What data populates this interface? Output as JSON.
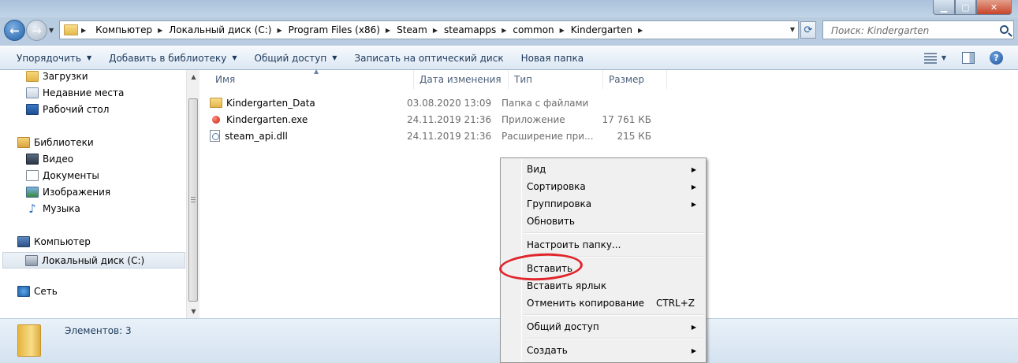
{
  "address": {
    "crumbs": [
      "Компьютер",
      "Локальный диск (C:)",
      "Program Files (x86)",
      "Steam",
      "steamapps",
      "common",
      "Kindergarten"
    ]
  },
  "search": {
    "placeholder": "Поиск: Kindergarten"
  },
  "toolbar": {
    "organize": "Упорядочить",
    "add_to_library": "Добавить в библиотеку",
    "share": "Общий доступ",
    "burn": "Записать на оптический диск",
    "new_folder": "Новая папка"
  },
  "sidebar": {
    "downloads": "Загрузки",
    "recent": "Недавние места",
    "desktop": "Рабочий стол",
    "libraries": "Библиотеки",
    "video": "Видео",
    "documents": "Документы",
    "images": "Изображения",
    "music": "Музыка",
    "computer": "Компьютер",
    "local_disk": "Локальный диск (C:)",
    "network": "Сеть"
  },
  "columns": {
    "name": "Имя",
    "date": "Дата изменения",
    "type": "Тип",
    "size": "Размер"
  },
  "files": [
    {
      "name": "Kindergarten_Data",
      "date": "03.08.2020 13:09",
      "type": "Папка с файлами",
      "size": ""
    },
    {
      "name": "Kindergarten.exe",
      "date": "24.11.2019 21:36",
      "type": "Приложение",
      "size": "17 761 КБ"
    },
    {
      "name": "steam_api.dll",
      "date": "24.11.2019 21:36",
      "type": "Расширение при...",
      "size": "215 КБ"
    }
  ],
  "status": {
    "items_count": "Элементов: 3"
  },
  "context_menu": {
    "view": "Вид",
    "sort": "Сортировка",
    "group": "Группировка",
    "refresh": "Обновить",
    "customize": "Настроить папку...",
    "paste": "Вставить",
    "paste_shortcut": "Вставить ярлык",
    "undo_copy": "Отменить копирование",
    "undo_copy_shortcut": "CTRL+Z",
    "share": "Общий доступ",
    "create": "Создать"
  },
  "colors": {
    "highlight_circle": "#e0252b",
    "toolbar_text": "#1e395b"
  }
}
